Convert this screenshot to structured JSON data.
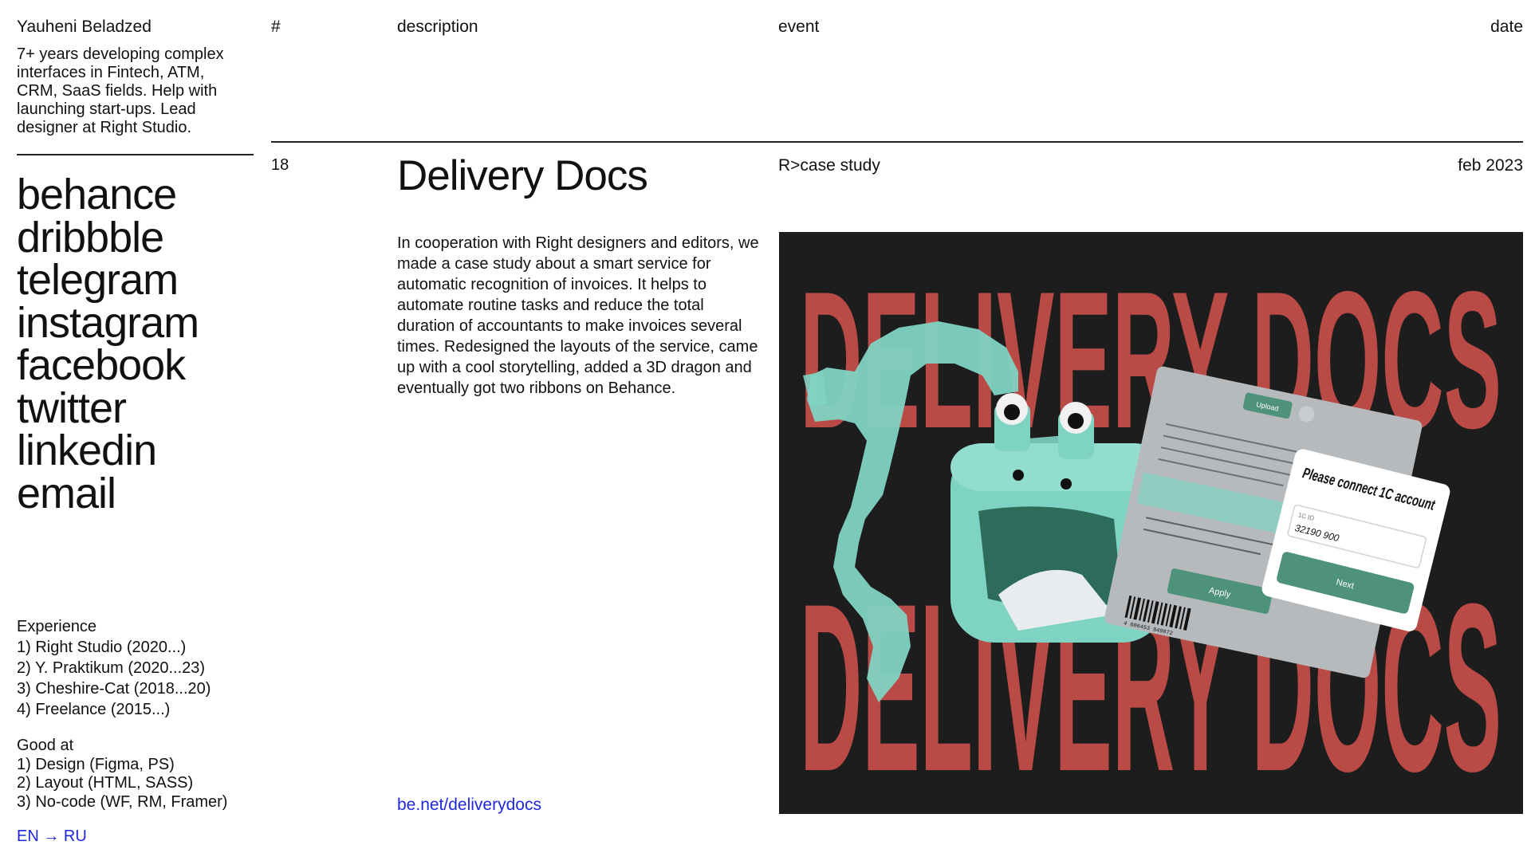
{
  "profile": {
    "name": "Yauheni Beladzed",
    "bio": "7+ years developing complex interfaces in Fintech, ATM, CRM, SaaS fields. Help with launching start-ups. Lead designer at Right Studio."
  },
  "social_links": [
    "behance",
    "dribbble",
    "telegram",
    "instagram",
    "facebook",
    "twitter",
    "linkedin",
    "email"
  ],
  "experience": {
    "heading": "Experience",
    "items": [
      "1) Right Studio (2020...)",
      "2) Y. Praktikum (2020...23)",
      "3) Cheshire-Cat (2018...20)",
      "4) Freelance (2015...)"
    ]
  },
  "skills": {
    "heading": "Good at",
    "items": [
      "1) Design (Figma, PS)",
      "2) Layout (HTML, SASS)",
      "3) No-code (WF, RM, Framer)"
    ]
  },
  "language_switch": "EN → RU",
  "table_header": {
    "number": "#",
    "description": "description",
    "event": "event",
    "date": "date"
  },
  "entry": {
    "number": "18",
    "title": "Delivery Docs",
    "event": "R>case study",
    "date": "feb 2023",
    "description": "In cooperation with Right designers and editors, we made a case study about a smart service for automatic recognition of invoices. It helps to automate routine tasks and reduce the total duration of accountants to make invoices several times. Redesigned the layouts of the service, came up with a cool storytelling, added a 3D dragon and eventually got two ribbons on Behance.",
    "link": "be.net/deliverydocs"
  },
  "hero_image": {
    "background_text": "DELIVERY DOCS",
    "card": {
      "upload": "Upload",
      "apply": "Apply",
      "barcode_number": "4 606453 849072",
      "dialog_title": "Please connect 1C account",
      "field_label": "1C ID",
      "field_value": "32190 900",
      "next": "Next"
    }
  },
  "colors": {
    "accent_link": "#1f28e0",
    "hero_bg": "#1d1d1d",
    "hero_text": "#b94a45",
    "dragon": "#7fd3c3",
    "button": "#4f927c"
  }
}
